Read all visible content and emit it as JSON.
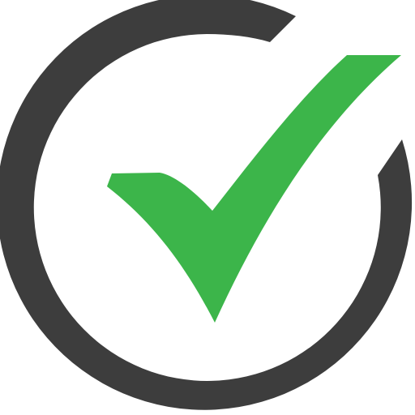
{
  "icon": {
    "name": "check-circle-icon",
    "colors": {
      "ring": "#3d3d3d",
      "check": "#3cb54a",
      "background": "#ffffff"
    }
  }
}
